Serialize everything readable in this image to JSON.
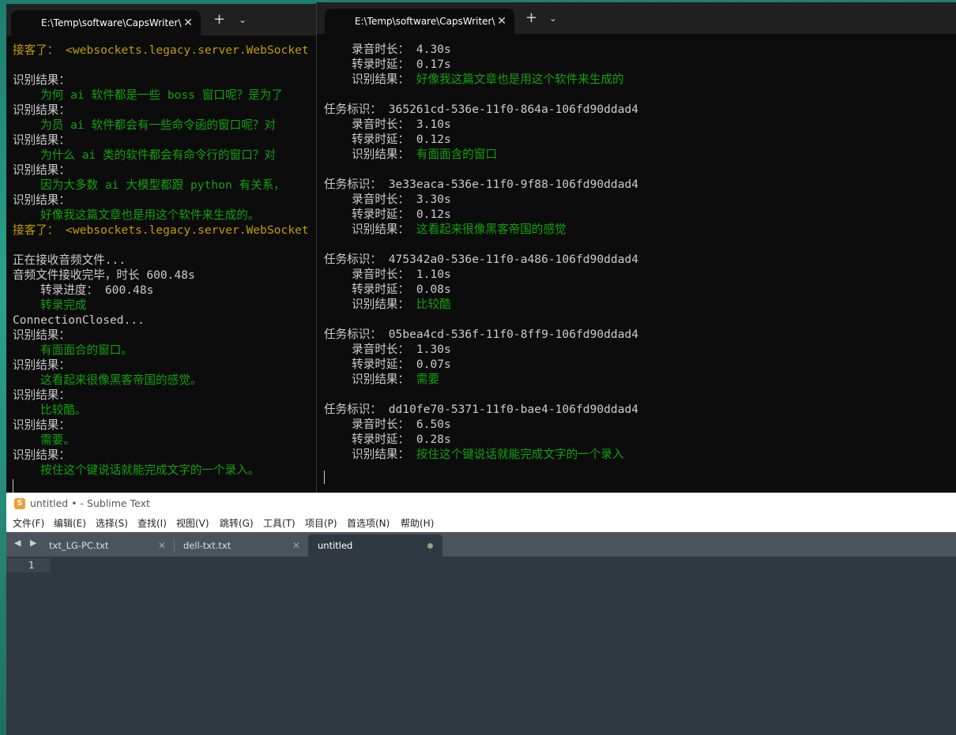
{
  "left_terminal": {
    "tab_title": "E:\\Temp\\software\\CapsWriter\\",
    "tab_close": "✕",
    "new_tab": "+",
    "dropdown": "⌄",
    "lines": [
      {
        "t": "接客了： <websockets.legacy.server.WebSocket",
        "c": "y"
      },
      {
        "t": "",
        "c": ""
      },
      {
        "t": "识别结果：",
        "c": ""
      },
      {
        "t": "    为何 ai 软件都是一些 boss 窗口呢？是为了",
        "c": "g"
      },
      {
        "t": "识别结果：",
        "c": ""
      },
      {
        "t": "    为员 ai 软件都会有一些命令函的窗口呢？对",
        "c": "g"
      },
      {
        "t": "识别结果：",
        "c": ""
      },
      {
        "t": "    为什么 ai 类的软件都会有命令行的窗口？对",
        "c": "g"
      },
      {
        "t": "识别结果：",
        "c": ""
      },
      {
        "t": "    因为大多数 ai 大模型都跟 python 有关系，",
        "c": "g"
      },
      {
        "t": "识别结果：",
        "c": ""
      },
      {
        "t": "    好像我这篇文章也是用这个软件来生成的。",
        "c": "g"
      },
      {
        "t": "接客了： <websockets.legacy.server.WebSocket",
        "c": "y"
      },
      {
        "t": "",
        "c": ""
      },
      {
        "t": "正在接收音频文件...",
        "c": ""
      },
      {
        "t": "音频文件接收完毕，时长 600.48s",
        "c": ""
      },
      {
        "t": "    转录进度： 600.48s",
        "c": ""
      },
      {
        "t": "    转录完成",
        "c": "g"
      },
      {
        "t": "ConnectionClosed...",
        "c": ""
      },
      {
        "t": "识别结果：",
        "c": ""
      },
      {
        "t": "    有面面合的窗口。",
        "c": "g"
      },
      {
        "t": "识别结果：",
        "c": ""
      },
      {
        "t": "    这看起来很像黑客帝国的感觉。",
        "c": "g"
      },
      {
        "t": "识别结果：",
        "c": ""
      },
      {
        "t": "    比较酷。",
        "c": "g"
      },
      {
        "t": "识别结果：",
        "c": ""
      },
      {
        "t": "    需要。",
        "c": "g"
      },
      {
        "t": "识别结果：",
        "c": ""
      },
      {
        "t": "    按住这个键说话就能完成文字的一个录入。",
        "c": "g"
      }
    ]
  },
  "right_terminal": {
    "tab_title": "E:\\Temp\\software\\CapsWriter\\",
    "tab_close": "✕",
    "new_tab": "+",
    "dropdown": "⌄",
    "lines": [
      {
        "p": "    录音时长：",
        "v": " 4.30s",
        "c": ""
      },
      {
        "p": "    转录时延：",
        "v": " 0.17s",
        "c": ""
      },
      {
        "p": "    识别结果：",
        "v": " 好像我这篇文章也是用这个软件来生成的",
        "c": "g"
      },
      {
        "p": "",
        "v": "",
        "c": ""
      },
      {
        "p": "任务标识：",
        "v": " 365261cd-536e-11f0-864a-106fd90ddad4",
        "c": ""
      },
      {
        "p": "    录音时长：",
        "v": " 3.10s",
        "c": ""
      },
      {
        "p": "    转录时延：",
        "v": " 0.12s",
        "c": ""
      },
      {
        "p": "    识别结果：",
        "v": " 有面面含的窗口",
        "c": "g"
      },
      {
        "p": "",
        "v": "",
        "c": ""
      },
      {
        "p": "任务标识：",
        "v": " 3e33eaca-536e-11f0-9f88-106fd90ddad4",
        "c": ""
      },
      {
        "p": "    录音时长：",
        "v": " 3.30s",
        "c": ""
      },
      {
        "p": "    转录时延：",
        "v": " 0.12s",
        "c": ""
      },
      {
        "p": "    识别结果：",
        "v": " 这看起来很像黑客帝国的感觉",
        "c": "g"
      },
      {
        "p": "",
        "v": "",
        "c": ""
      },
      {
        "p": "任务标识：",
        "v": " 475342a0-536e-11f0-a486-106fd90ddad4",
        "c": ""
      },
      {
        "p": "    录音时长：",
        "v": " 1.10s",
        "c": ""
      },
      {
        "p": "    转录时延：",
        "v": " 0.08s",
        "c": ""
      },
      {
        "p": "    识别结果：",
        "v": " 比较酷",
        "c": "g"
      },
      {
        "p": "",
        "v": "",
        "c": ""
      },
      {
        "p": "任务标识：",
        "v": " 05bea4cd-536f-11f0-8ff9-106fd90ddad4",
        "c": ""
      },
      {
        "p": "    录音时长：",
        "v": " 1.30s",
        "c": ""
      },
      {
        "p": "    转录时延：",
        "v": " 0.07s",
        "c": ""
      },
      {
        "p": "    识别结果：",
        "v": " 需要",
        "c": "g"
      },
      {
        "p": "",
        "v": "",
        "c": ""
      },
      {
        "p": "任务标识：",
        "v": " dd10fe70-5371-11f0-bae4-106fd90ddad4",
        "c": ""
      },
      {
        "p": "    录音时长：",
        "v": " 6.50s",
        "c": ""
      },
      {
        "p": "    转录时延：",
        "v": " 0.28s",
        "c": ""
      },
      {
        "p": "    识别结果：",
        "v": " 按住这个键说话就能完成文字的一个录入",
        "c": "g"
      }
    ]
  },
  "sublime": {
    "title": "untitled • - Sublime Text",
    "logo": "S",
    "menu": [
      "文件(F)",
      "编辑(E)",
      "选择(S)",
      "查找(I)",
      "视图(V)",
      "跳转(G)",
      "工具(T)",
      "项目(P)",
      "首选项(N)",
      "帮助(H)"
    ],
    "tab_arrows": "◀ ▶",
    "tabs": [
      {
        "label": "txt_LG-PC.txt",
        "close": "✕"
      },
      {
        "label": "dell-txt.txt",
        "close": "✕"
      },
      {
        "label": "untitled"
      }
    ],
    "line_number": "1"
  },
  "colors": {
    "terminal_bg": "#0c0c0c",
    "terminal_text": "#cccccc",
    "terminal_yellow": "#c19c00",
    "terminal_green": "#13a10e",
    "sublime_bg": "#303841"
  }
}
